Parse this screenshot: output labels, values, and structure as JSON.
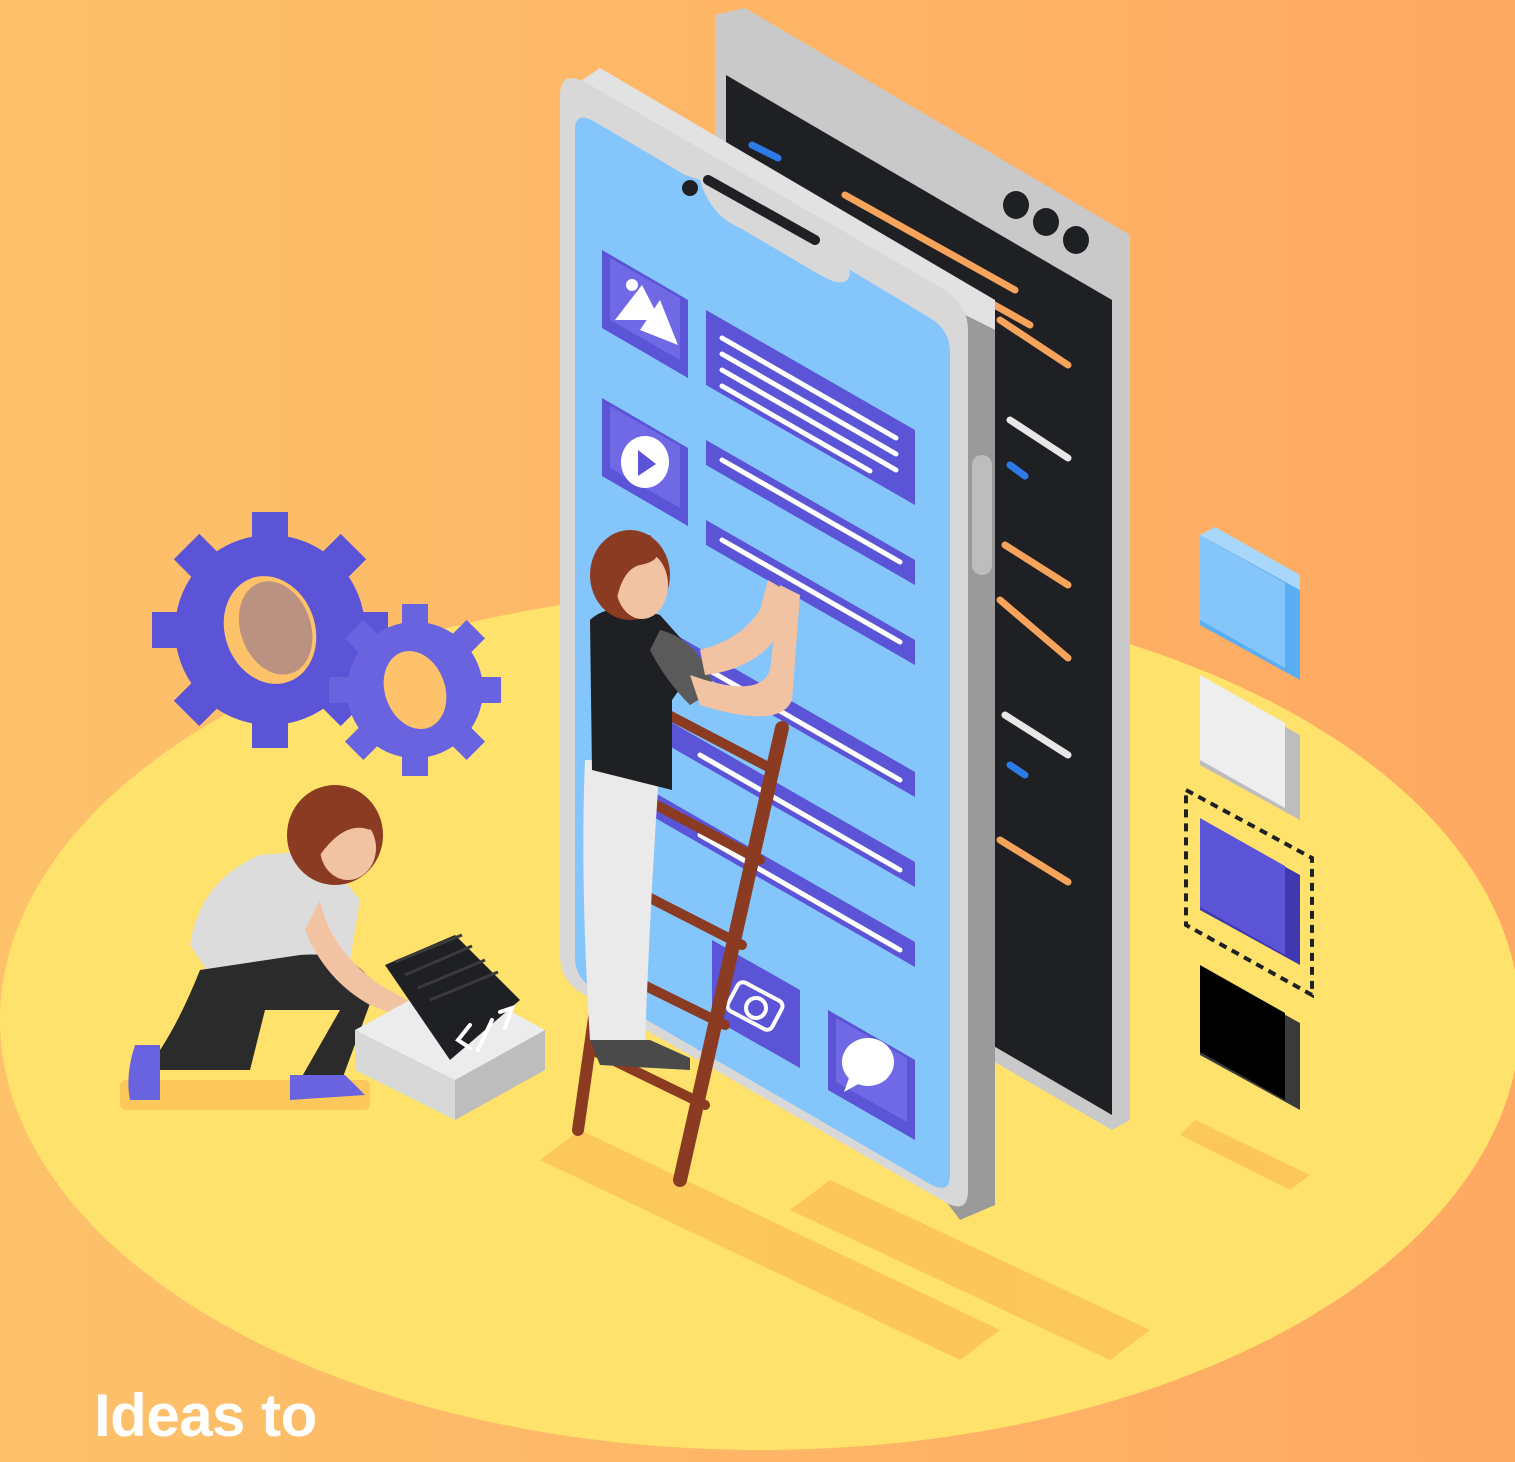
{
  "headline": "Ideas to",
  "colors": {
    "background_left": "#fdbf67",
    "background_right": "#fea962",
    "platform": "#fee26b",
    "phone_frame": "#d6d6d6",
    "phone_screen": "#84c5fb",
    "code_screen": "#1f2024",
    "accent_purple": "#5b54d6",
    "code_orange": "#f6a35c",
    "ladder": "#8b3b22"
  },
  "icons": [
    "image-icon",
    "play-icon",
    "camera-icon",
    "chat-bubble-icon",
    "gear-icon",
    "code-icon"
  ]
}
